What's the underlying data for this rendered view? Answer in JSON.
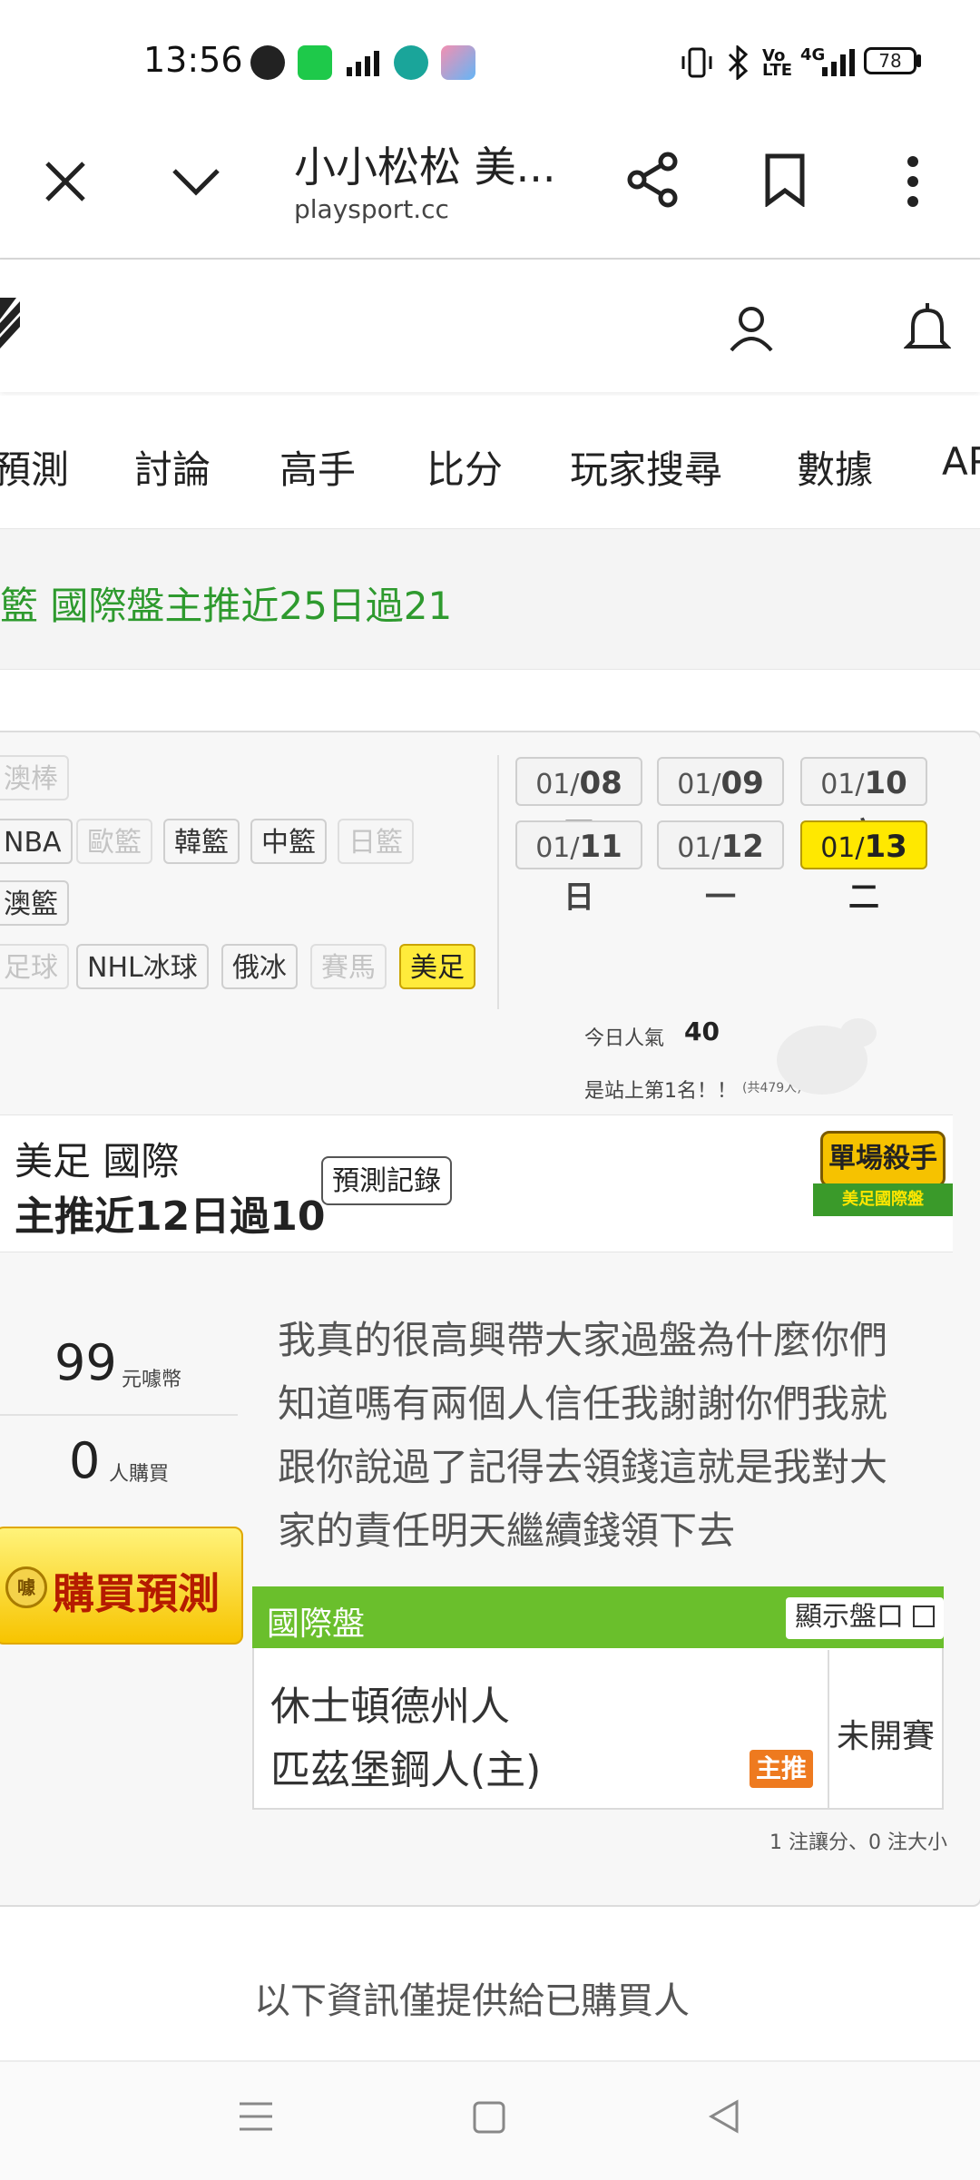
{
  "status_bar": {
    "time": "13:56",
    "network_label": "4G",
    "battery": "78",
    "icons": [
      "line-icon",
      "green-app-icon",
      "signal-app-icon",
      "teal-app-icon",
      "game-app-icon",
      "vibrate-icon",
      "bluetooth-icon",
      "volte-icon",
      "cell-signal-icon"
    ]
  },
  "browser": {
    "title": "小小松松 美...",
    "url": "playsport.cc",
    "icons": [
      "close-icon",
      "chevron-down-icon",
      "share-icon",
      "bookmark-icon",
      "more-vert-icon"
    ]
  },
  "site_header": {
    "icons": [
      "logo-icon",
      "user-icon",
      "bell-icon"
    ]
  },
  "nav": {
    "items": [
      "預測",
      "討論",
      "高手",
      "比分",
      "玩家搜尋",
      "數據",
      "APP"
    ]
  },
  "banner": {
    "text": "籃 國際盤主推近25日過21"
  },
  "sports": {
    "row1": [
      "澳棒"
    ],
    "row2": [
      "NBA",
      "歐籃",
      "韓籃",
      "中籃",
      "日籃"
    ],
    "row3": [
      "澳籃"
    ],
    "row4": [
      "足球",
      "NHL冰球",
      "俄冰",
      "賽馬",
      "美足"
    ],
    "selected": "美足"
  },
  "dates": [
    {
      "month": "01/",
      "day": "08",
      "weekday": "四"
    },
    {
      "month": "01/",
      "day": "09",
      "weekday": "五"
    },
    {
      "month": "01/",
      "day": "10",
      "weekday": "六"
    },
    {
      "month": "01/",
      "day": "11",
      "weekday": "日"
    },
    {
      "month": "01/",
      "day": "12",
      "weekday": "一"
    },
    {
      "month": "01/",
      "day": "13",
      "weekday": "二"
    }
  ],
  "popularity": {
    "label": "今日人氣",
    "value": "40",
    "rank_text": "是站上第1名！！",
    "total": "(共479人)"
  },
  "profile": {
    "category": "美足 國際",
    "record": "主推近12日過10",
    "history_button": "預測記錄",
    "badge_title": "單場殺手",
    "badge_sub": "美足國際盤"
  },
  "purchase": {
    "price": "99",
    "price_unit": "元噱幣",
    "buyers": "0",
    "buyers_unit": "人購買",
    "buy_button": "購買預測",
    "coin_char": "噱"
  },
  "description": "我真的很高興帶大家過盤為什麼你們知道嗎有兩個人信任我謝謝你們我就跟你說過了記得去領錢這就是我對大家的責任明天繼續錢領下去",
  "match": {
    "header": "國際盤",
    "show_button": "顯示盤口",
    "team_away": "休士頓德州人",
    "team_home": "匹茲堡鋼人(主)",
    "recommend_badge": "主推",
    "status": "未開賽",
    "counts": "1 注讓分、0 注大小"
  },
  "footer_note": "以下資訊僅提供給已購買人",
  "colors": {
    "accent_green": "#6abf2c",
    "banner_green": "#2e9a2e",
    "selected_yellow": "#ffe800",
    "badge_orange": "#ee7a1f"
  }
}
